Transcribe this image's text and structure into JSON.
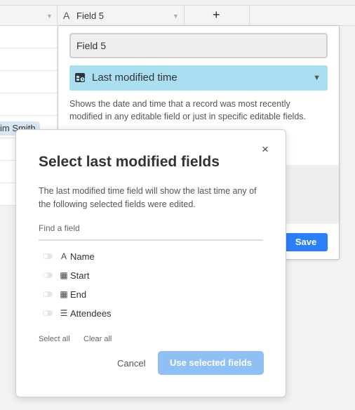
{
  "grid": {
    "field_header_label": "Field 5",
    "add_field": "+",
    "chip_text": "im Smith"
  },
  "panel": {
    "field_name_value": "Field 5",
    "field_type_label": "Last modified time",
    "description": "Shows the date and time that a record was most recently modified in any editable field or just in specific editable fields.",
    "save_label": "Save"
  },
  "modal": {
    "close_glyph": "×",
    "title": "Select last modified fields",
    "description": "The last modified time field will show the last time any of the following selected fields were edited.",
    "search_placeholder": "Find a field",
    "fields": [
      {
        "label": "Name",
        "icon": "text-field-icon",
        "glyph": "A"
      },
      {
        "label": "Start",
        "icon": "date-field-icon",
        "glyph": "▦"
      },
      {
        "label": "End",
        "icon": "date-field-icon",
        "glyph": "▦"
      },
      {
        "label": "Attendees",
        "icon": "multiselect-field-icon",
        "glyph": "☰"
      }
    ],
    "select_all": "Select all",
    "clear_all": "Clear all",
    "cancel_label": "Cancel",
    "confirm_label": "Use selected fields"
  },
  "colors": {
    "type_selector_bg": "#a9dff0",
    "save_button_bg": "#2d7ff9",
    "confirm_button_bg": "#8fc0f5",
    "chip_bg": "#d8e6f3"
  }
}
